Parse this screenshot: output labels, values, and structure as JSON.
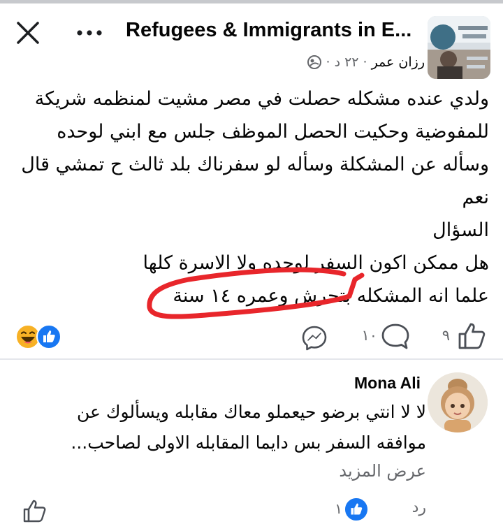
{
  "header": {
    "group_name": "Refugees & Immigrants in E...",
    "close_icon": "close-icon",
    "more_icon": "more-icon"
  },
  "post": {
    "author": "رزان عمر",
    "time": "٢٢ د",
    "audience_icon": "globe-icon",
    "lines": [
      "ولدي عنده مشكله حصلت في مصر مشيت لمنظمه شريكة",
      "للمفوضية وحكيت الحصل الموظف جلس مع ابني لوحده",
      "وسأله عن المشكلة وسأله لو سفرناك بلد ثالث ح تمشي قال",
      "نعم",
      "السؤال",
      "هل ممكن اكون السفر لوحده ولا الاسرة كلها",
      "علما انه المشكله بتحرش وعمره ١٤ سنة"
    ],
    "annotation_color": "#e8262b"
  },
  "actions": {
    "reactions": [
      "haha",
      "like"
    ],
    "like_count": "٩",
    "comment_count": "١٠",
    "like_color": "#1877f2"
  },
  "comment": {
    "name": "Mona Ali",
    "lines": [
      "لا لا انتي برضو حيعملو معاك مقابله ويسألوك عن",
      "موافقه السفر بس دايما المقابله الاولى لصاحب..."
    ],
    "see_more": "عرض المزيد",
    "reply": "رد",
    "like_count": "١"
  }
}
